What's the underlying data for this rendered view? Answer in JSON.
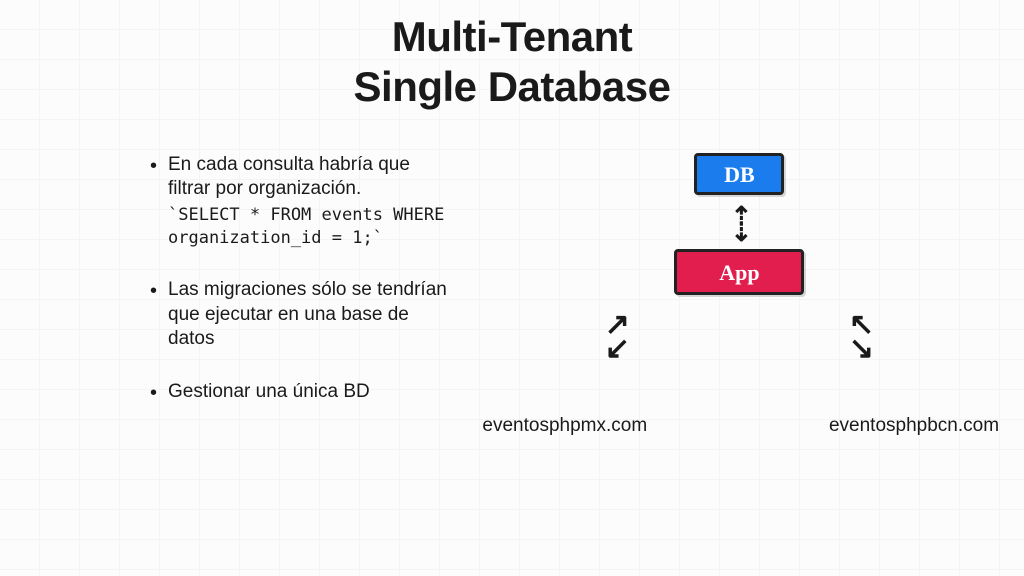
{
  "title_line1": "Multi-Tenant",
  "title_line2": "Single Database",
  "bullets": {
    "b1_text": "En cada consulta habría que filtrar por organización.",
    "b1_code": "`SELECT * FROM events WHERE organization_id = 1;`",
    "b2_text": "Las migraciones sólo se tendrían que ejecutar en una base de datos",
    "b3_text": "Gestionar una única BD"
  },
  "diagram": {
    "db_label": "DB",
    "app_label": "App",
    "domain_left": "eventosphpmx.com",
    "domain_right": "eventosphpbcn.com"
  }
}
